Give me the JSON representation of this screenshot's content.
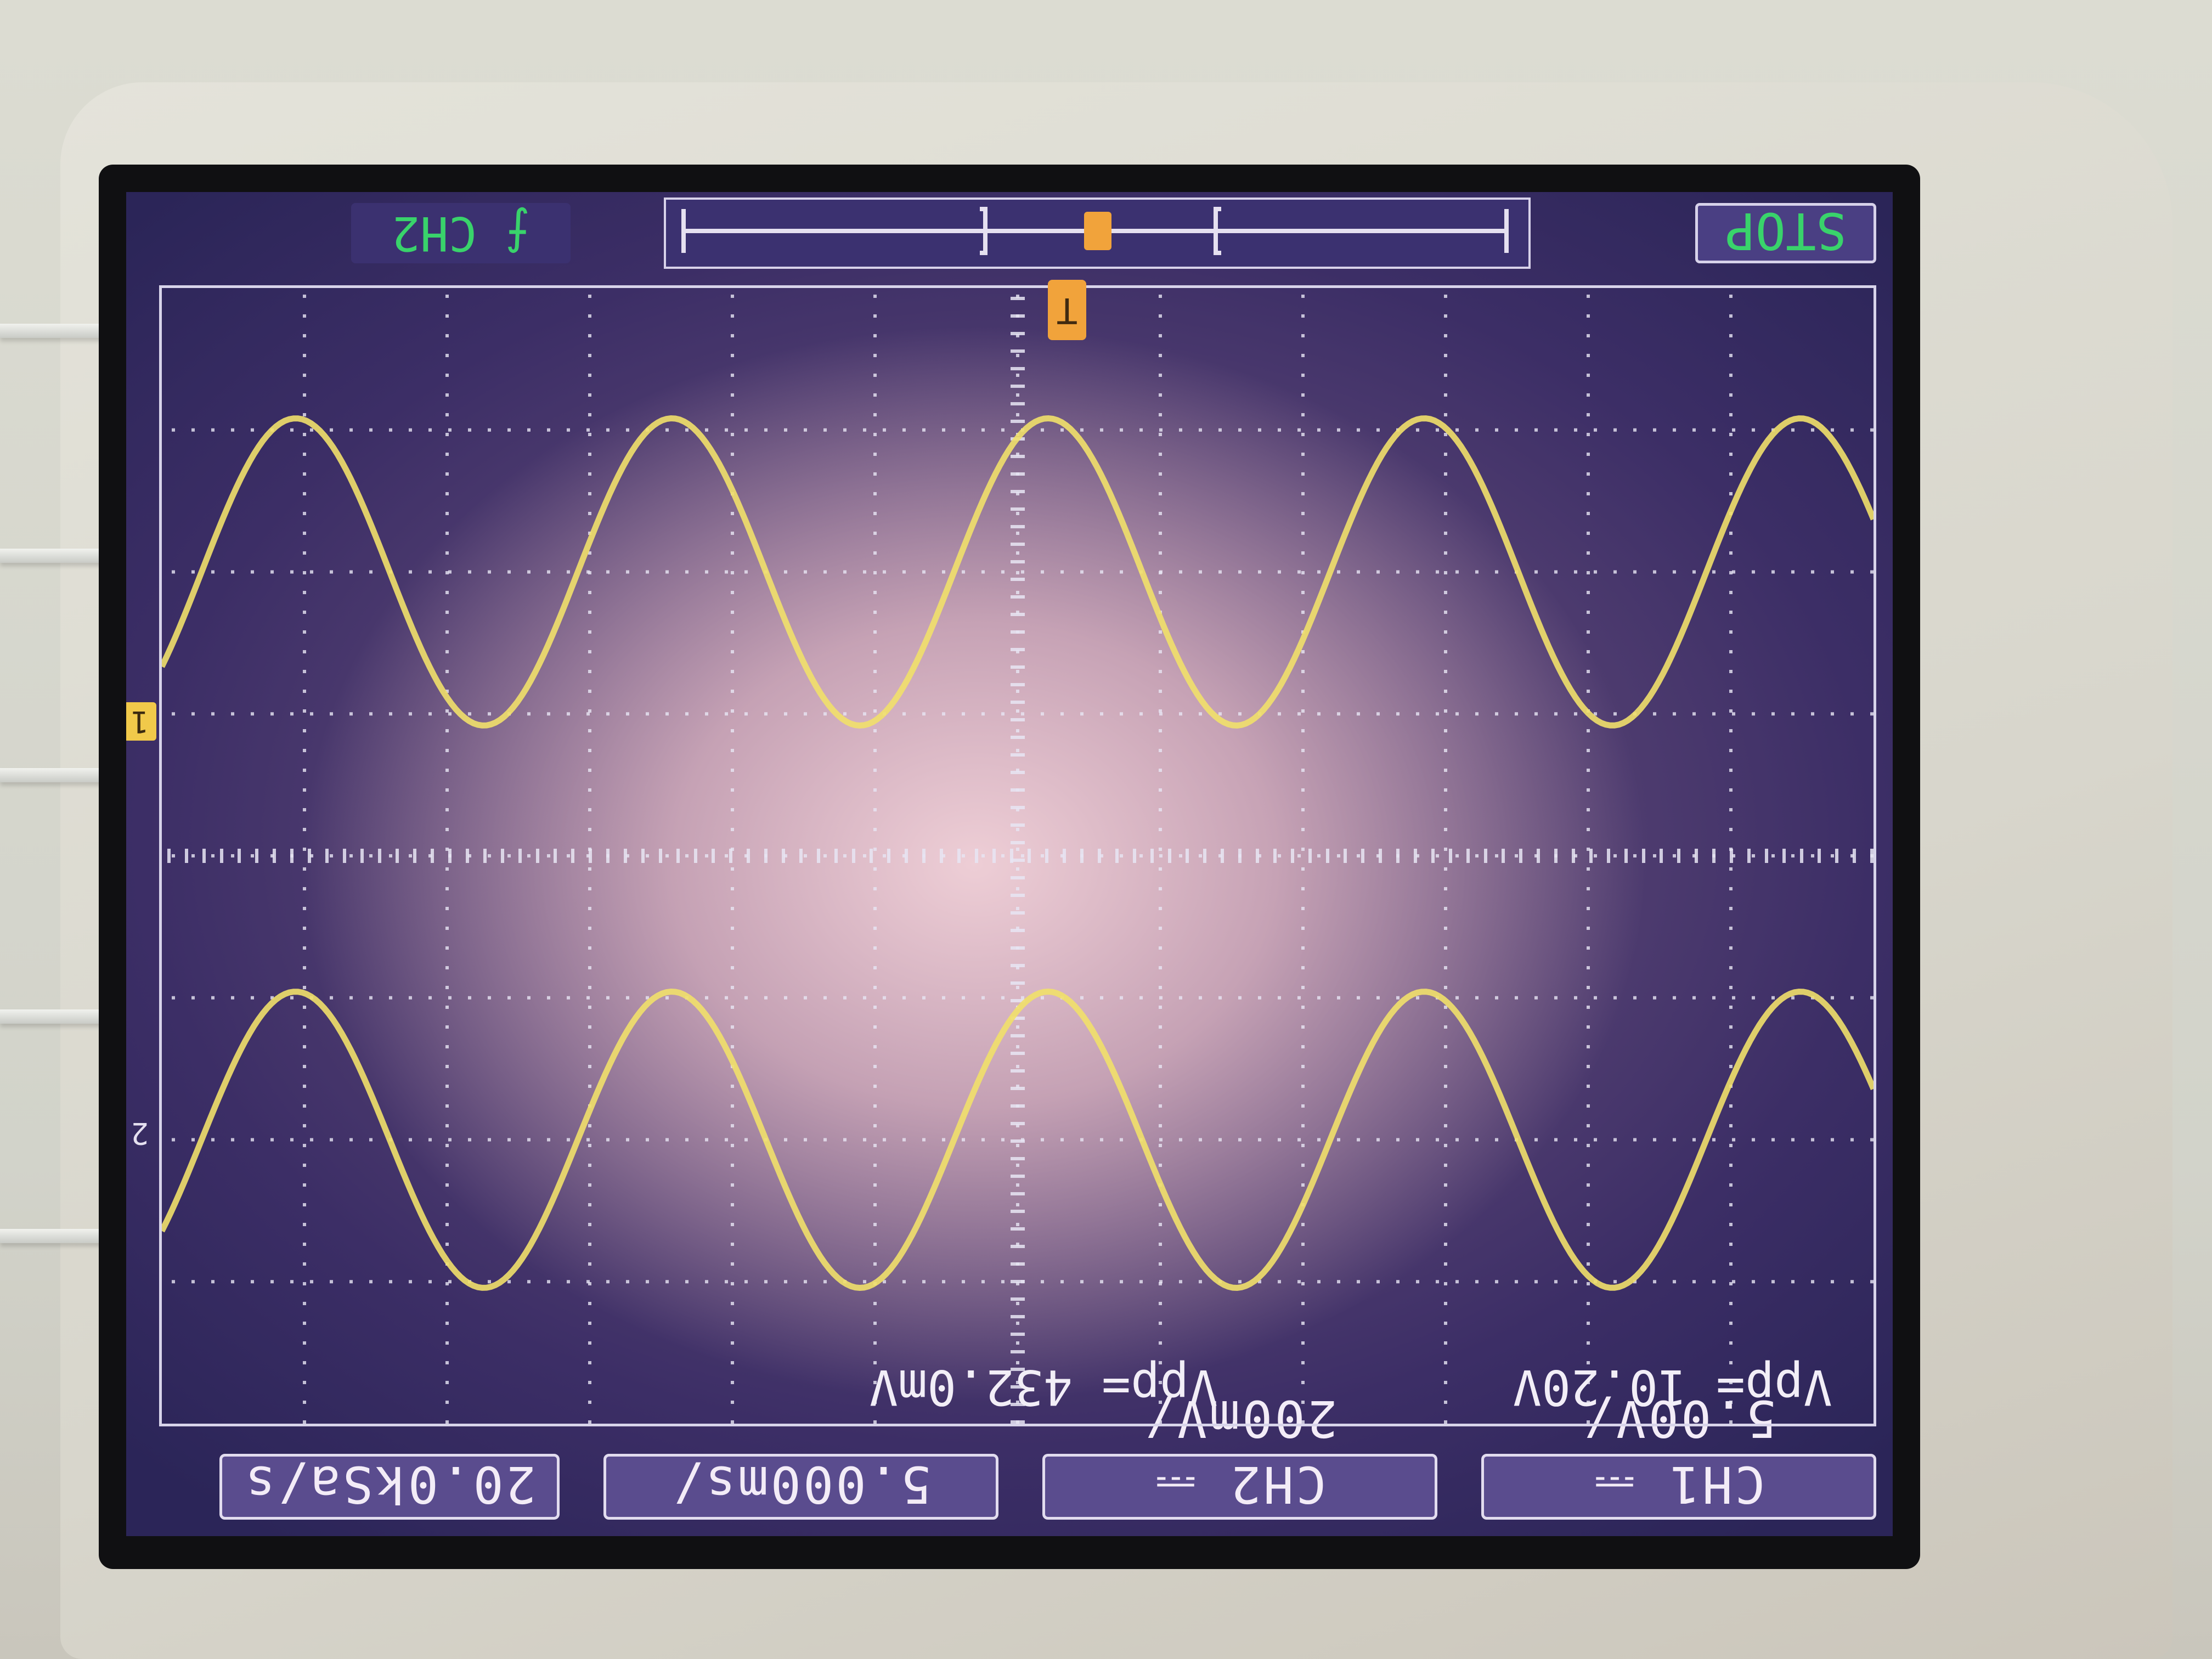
{
  "top_bar": {
    "ch1": "CH1 ⎓  5.00V/",
    "ch2": "CH2 ⎓  200mV/",
    "timebase": "5.000ms/",
    "sample_rate": "20.0kSa/s"
  },
  "measurements": {
    "vpp_ch1": "Vpp= 10.20V",
    "vpp_ch2": "Vpp= 432.0mV"
  },
  "bottom_bar": {
    "run_state": "STOP",
    "trigger_source": "CH2",
    "trigger_slope": "⨍"
  },
  "markers": {
    "trigger": "T",
    "ch1": "1",
    "ch2": "2"
  },
  "colors": {
    "trace": "#f1e06a",
    "grid": "#e8e6f4",
    "status_text": "#39d36b"
  }
}
